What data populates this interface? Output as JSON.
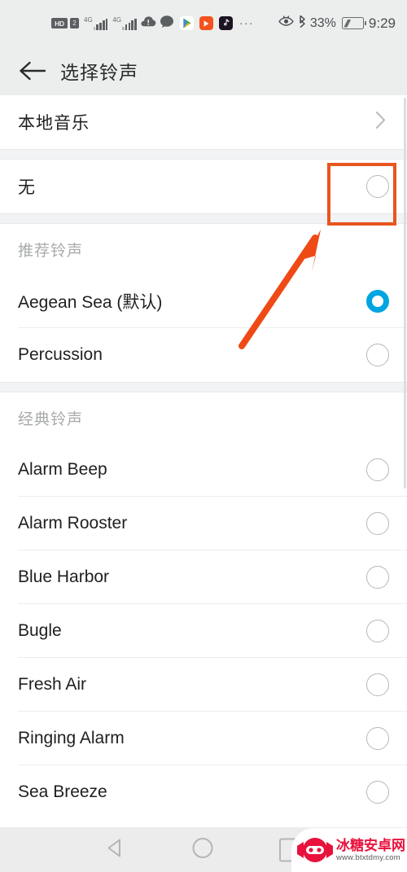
{
  "status_bar": {
    "hd_label": "HD",
    "sim_label": "2",
    "network_label_1": "4G",
    "network_label_2": "4G",
    "overflow_dots": "···",
    "battery_percent": "33%",
    "time": "9:29",
    "icons": [
      "hd-icon",
      "sim2-icon",
      "signal-4g-1-icon",
      "signal-4g-2-icon",
      "cloud-alert-icon",
      "chat-bubble-icon",
      "play-store-icon",
      "video-app-icon",
      "tiktok-icon",
      "overflow-dots-icon",
      "eye-comfort-icon",
      "bluetooth-icon",
      "battery-charging-icon"
    ],
    "app_colors": {
      "cloud": "#5b5f62",
      "chat": "#5b5f62",
      "play": "#34a853",
      "video": "#f4511e",
      "tiktok": "#1c1422"
    }
  },
  "title_bar": {
    "back_icon": "back-arrow-icon",
    "title": "选择铃声"
  },
  "sections": [
    {
      "id": "local-music",
      "header": null,
      "rows": [
        {
          "label": "本地音乐",
          "type": "chevron",
          "cn": true
        }
      ]
    },
    {
      "id": "none",
      "header": null,
      "rows": [
        {
          "label": "无",
          "type": "radio",
          "selected": false,
          "cn": true,
          "highlighted": true
        }
      ]
    },
    {
      "id": "recommended",
      "header": "推荐铃声",
      "rows": [
        {
          "label": "Aegean Sea (默认)",
          "type": "radio",
          "selected": true
        },
        {
          "label": "Percussion",
          "type": "radio",
          "selected": false
        }
      ]
    },
    {
      "id": "classic",
      "header": "经典铃声",
      "rows": [
        {
          "label": "Alarm Beep",
          "type": "radio",
          "selected": false
        },
        {
          "label": "Alarm Rooster",
          "type": "radio",
          "selected": false
        },
        {
          "label": "Blue Harbor",
          "type": "radio",
          "selected": false
        },
        {
          "label": "Bugle",
          "type": "radio",
          "selected": false
        },
        {
          "label": "Fresh Air",
          "type": "radio",
          "selected": false
        },
        {
          "label": "Ringing Alarm",
          "type": "radio",
          "selected": false
        },
        {
          "label": "Sea Breeze",
          "type": "radio",
          "selected": false
        }
      ]
    }
  ],
  "annotations": {
    "highlight_box": {
      "name": "none-radio-highlight-box",
      "color": "#e8551f",
      "target": "无"
    },
    "arrow": {
      "name": "pointer-arrow",
      "color": "#ef4a16",
      "points_to": "无"
    }
  },
  "nav_bar": {
    "back": "nav-back-icon",
    "home": "nav-home-icon",
    "recents": "nav-recents-icon"
  },
  "watermark": {
    "title": "冰糖安卓网",
    "url": "www.btxtdmy.com",
    "logo_color": "#e8123c"
  },
  "colors": {
    "accent_selected": "#00a5e0",
    "annotation_orange": "#e8551f",
    "status_bar_bg": "#eceded",
    "section_gap_bg": "#f2f3f4"
  }
}
